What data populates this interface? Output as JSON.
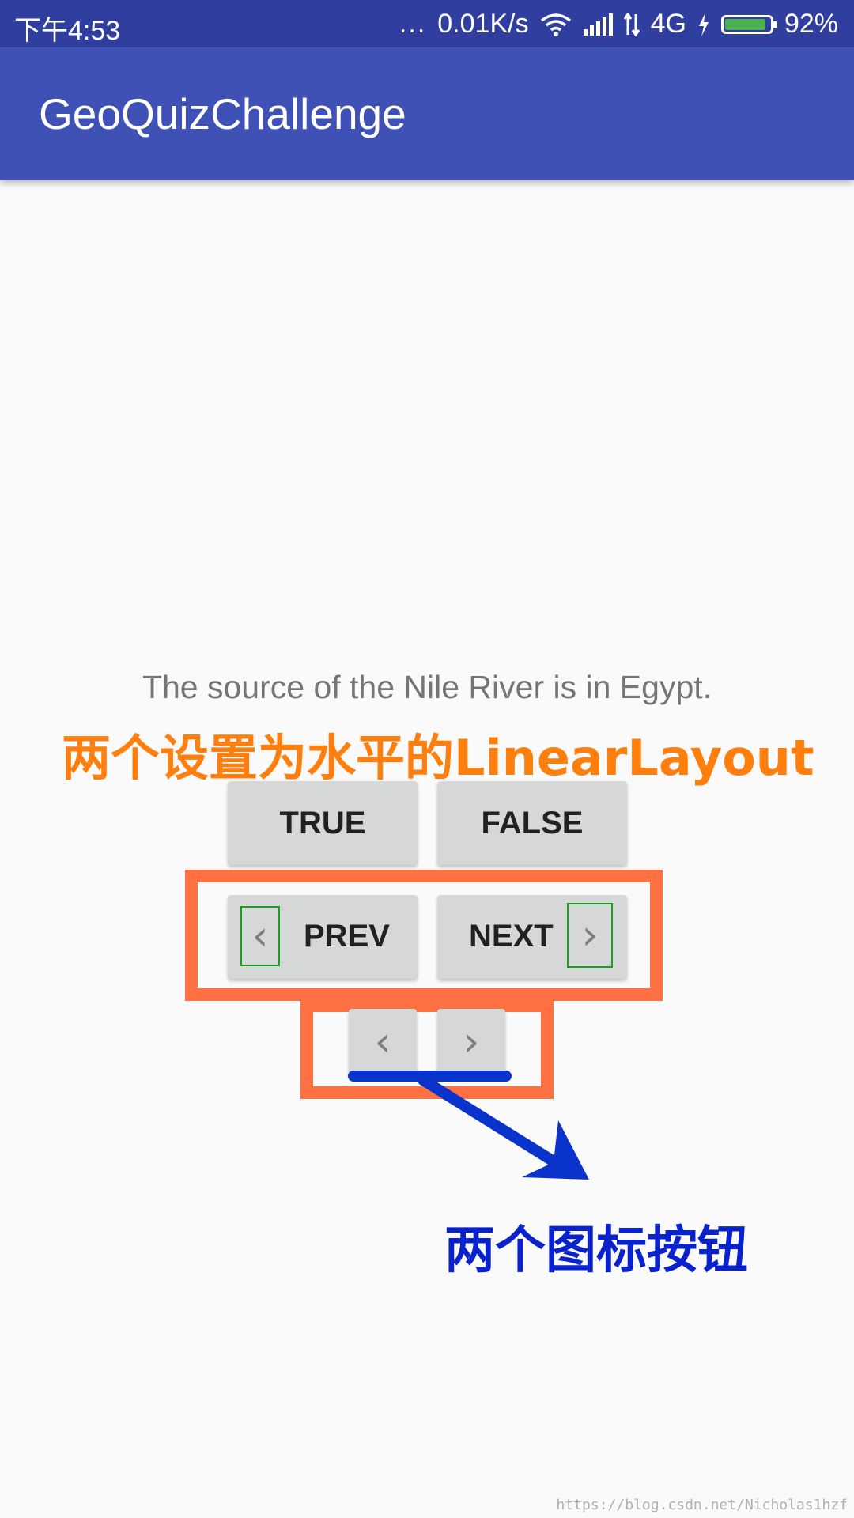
{
  "status_bar": {
    "time": "下午4:53",
    "dots": "...",
    "speed": "0.01K/s",
    "network": "4G",
    "battery": "92%",
    "battery_level": 0.92,
    "icons": [
      "wifi-icon",
      "signal-icon",
      "data-arrows-icon",
      "charging-icon",
      "battery-icon"
    ]
  },
  "app_bar": {
    "title": "GeoQuizChallenge"
  },
  "question": {
    "text": "The source of the Nile River is in Egypt."
  },
  "buttons": {
    "true_label": "TRUE",
    "false_label": "FALSE",
    "prev_label": "PREV",
    "next_label": "NEXT",
    "prev_icon": "‹",
    "next_icon": "›"
  },
  "annotations": {
    "linear_layout_note": "两个设置为水平的LinearLayout",
    "icon_buttons_note": "两个图标按钮",
    "orange_color": "#ff7f0e",
    "blue_color": "#0a22cc",
    "frame_color": "#ff7043"
  },
  "watermark": "https://blog.csdn.net/Nicholas1hzf",
  "colors": {
    "status_bar": "#303f9f",
    "app_bar": "#3f51b5",
    "button": "#d6d7d7"
  }
}
